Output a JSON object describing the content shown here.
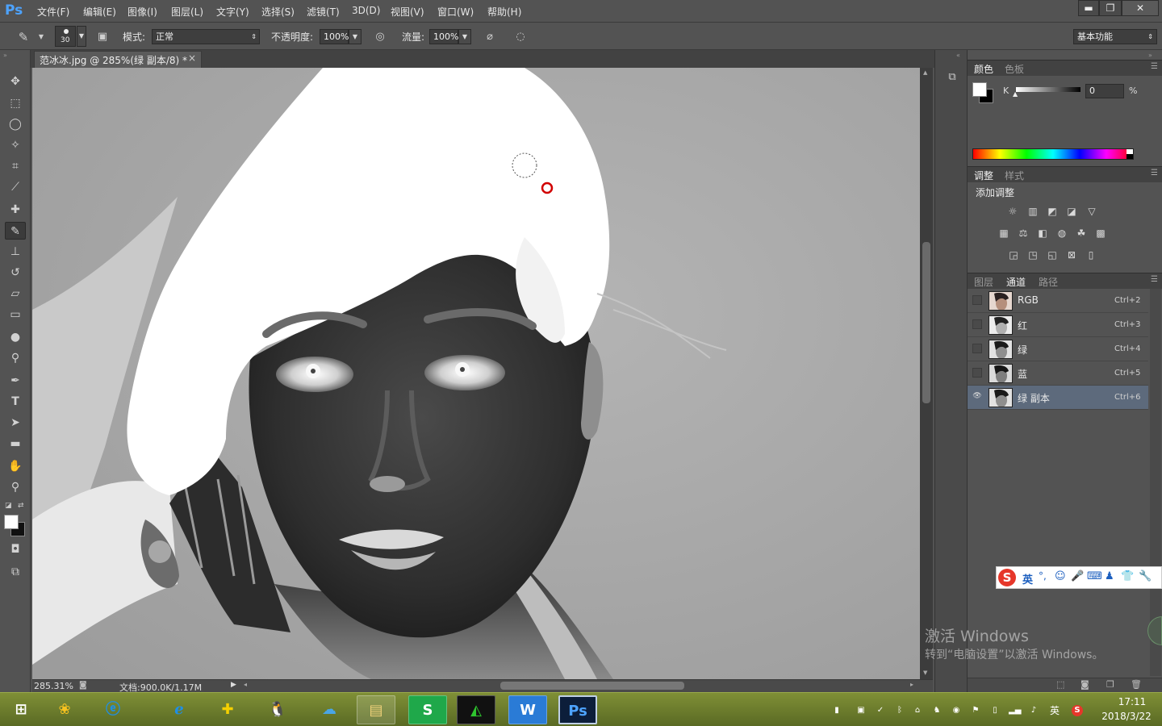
{
  "app": {
    "logo": "Ps"
  },
  "menu": [
    "文件(F)",
    "编辑(E)",
    "图像(I)",
    "图层(L)",
    "文字(Y)",
    "选择(S)",
    "滤镜(T)",
    "3D(D)",
    "视图(V)",
    "窗口(W)",
    "帮助(H)"
  ],
  "window_controls": {
    "minimize": "▬",
    "restore": "❐",
    "close": "✕"
  },
  "options": {
    "brush_size": "30",
    "mode_label": "模式:",
    "mode_value": "正常",
    "opacity_label": "不透明度:",
    "opacity_value": "100%",
    "flow_label": "流量:",
    "flow_value": "100%",
    "workspace": "基本功能"
  },
  "document": {
    "tab_title": "范冰冰.jpg @ 285%(绿 副本/8) *",
    "tab_close": "×",
    "zoom": "285.31%",
    "doc_info": "文档:900.0K/1.17M"
  },
  "color_panel": {
    "tabs": [
      "颜色",
      "色板"
    ],
    "active_tab": 0,
    "slider_label": "K",
    "slider_value": "0",
    "unit": "%",
    "slider_level": 0
  },
  "adjust_panel": {
    "tabs": [
      "调整",
      "样式"
    ],
    "active_tab": 0,
    "title": "添加调整",
    "icons_row1": [
      "brightness-icon",
      "levels-icon",
      "curves-icon",
      "exposure-icon",
      "vibrance-icon"
    ],
    "icons_row2": [
      "hue-sat-icon",
      "color-balance-icon",
      "bw-icon",
      "photo-filter-icon",
      "channel-mixer-icon",
      "color-lookup-icon"
    ],
    "icons_row3": [
      "invert-icon",
      "posterize-icon",
      "threshold-icon",
      "selective-color-icon",
      "gradient-map-icon"
    ]
  },
  "channels_panel": {
    "tabs": [
      "图层",
      "通道",
      "路径"
    ],
    "active_tab": 1,
    "rows": [
      {
        "name": "RGB",
        "shortcut": "Ctrl+2",
        "visible": false,
        "selected": false
      },
      {
        "name": "红",
        "shortcut": "Ctrl+3",
        "visible": false,
        "selected": false
      },
      {
        "name": "绿",
        "shortcut": "Ctrl+4",
        "visible": false,
        "selected": false
      },
      {
        "name": "蓝",
        "shortcut": "Ctrl+5",
        "visible": false,
        "selected": false
      },
      {
        "name": "绿 副本",
        "shortcut": "Ctrl+6",
        "visible": true,
        "selected": true
      }
    ]
  },
  "ime": {
    "mode": "英"
  },
  "watermark": {
    "line1": "激活 Windows",
    "line2": "转到“电脑设置”以激活 Windows。"
  },
  "taskbar": {
    "tray_lang": "英",
    "time": "17:11",
    "date": "2018/3/22"
  },
  "colors": {
    "ui_bg": "#535353",
    "panel_dark": "#424242",
    "selection": "#5d6a7c",
    "accent_ps": "#4da3ff",
    "brush_cursor": "#d10000",
    "taskbar": "#6b7a2c"
  }
}
